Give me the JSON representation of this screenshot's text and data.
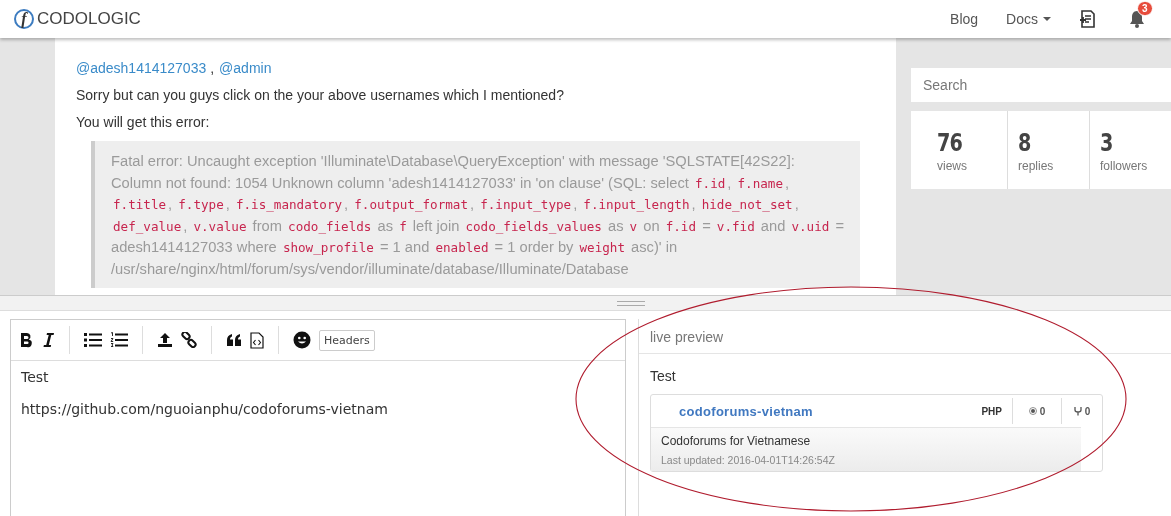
{
  "header": {
    "logo_letter": "f",
    "brand": "CODOLOGIC",
    "nav": [
      {
        "label": "Blog",
        "dropdown": false
      },
      {
        "label": "Docs",
        "dropdown": true
      }
    ],
    "notifications": "3"
  },
  "post": {
    "mentions": [
      "@adesh1414127033",
      "@admin"
    ],
    "mention_separator": ",",
    "paragraphs": [
      "Sorry but can you guys click on the your above usernames which I mentioned?",
      "You will get this error:"
    ],
    "quote": [
      {
        "kind": "text",
        "text": "Fatal error: Uncaught exception 'Illuminate\\Database\\QueryException' with message 'SQLSTATE[42S22]: Column not found: 1054 Unknown column 'adesh1414127033' in 'on clause' (SQL: select "
      },
      {
        "kind": "code",
        "text": "f.id"
      },
      {
        "kind": "text",
        "text": ", "
      },
      {
        "kind": "code",
        "text": "f.name"
      },
      {
        "kind": "text",
        "text": ", "
      },
      {
        "kind": "code",
        "text": "f.title"
      },
      {
        "kind": "text",
        "text": ", "
      },
      {
        "kind": "code",
        "text": "f.type"
      },
      {
        "kind": "text",
        "text": ", "
      },
      {
        "kind": "code",
        "text": "f.is_mandatory"
      },
      {
        "kind": "text",
        "text": ", "
      },
      {
        "kind": "code",
        "text": "f.output_format"
      },
      {
        "kind": "text",
        "text": ", "
      },
      {
        "kind": "code",
        "text": "f.input_type"
      },
      {
        "kind": "text",
        "text": ", "
      },
      {
        "kind": "code",
        "text": "f.input_length"
      },
      {
        "kind": "text",
        "text": ", "
      },
      {
        "kind": "code",
        "text": "hide_not_set"
      },
      {
        "kind": "text",
        "text": ", "
      },
      {
        "kind": "code",
        "text": "def_value"
      },
      {
        "kind": "text",
        "text": ", "
      },
      {
        "kind": "code",
        "text": "v.value"
      },
      {
        "kind": "text",
        "text": " from "
      },
      {
        "kind": "code",
        "text": "codo_fields"
      },
      {
        "kind": "text",
        "text": " as "
      },
      {
        "kind": "code",
        "text": "f"
      },
      {
        "kind": "text",
        "text": " left join "
      },
      {
        "kind": "code",
        "text": "codo_fields_values"
      },
      {
        "kind": "text",
        "text": " as "
      },
      {
        "kind": "code",
        "text": "v"
      },
      {
        "kind": "text",
        "text": " on "
      },
      {
        "kind": "code",
        "text": "f.id"
      },
      {
        "kind": "text",
        "text": " = "
      },
      {
        "kind": "code",
        "text": "v.fid"
      },
      {
        "kind": "text",
        "text": " and "
      },
      {
        "kind": "code",
        "text": "v.uid"
      },
      {
        "kind": "text",
        "text": " = adesh1414127033 where "
      },
      {
        "kind": "code",
        "text": "show_profile"
      },
      {
        "kind": "text",
        "text": " = 1 and "
      },
      {
        "kind": "code",
        "text": "enabled"
      },
      {
        "kind": "text",
        "text": " = 1 order by "
      },
      {
        "kind": "code",
        "text": "weight"
      },
      {
        "kind": "text",
        "text": " asc)' in /usr/share/nginx/html/forum/sys/vendor/illuminate/database/Illuminate/Database"
      }
    ]
  },
  "sidebar": {
    "search": {
      "placeholder": "Search"
    },
    "stats": [
      {
        "value": "76",
        "label": "views"
      },
      {
        "value": "8",
        "label": "replies"
      },
      {
        "value": "3",
        "label": "followers"
      }
    ]
  },
  "editor": {
    "toolbar": [
      {
        "kind": "bold"
      },
      {
        "kind": "italic"
      },
      {
        "kind": "sep"
      },
      {
        "kind": "ul"
      },
      {
        "kind": "ol"
      },
      {
        "kind": "sep"
      },
      {
        "kind": "upload"
      },
      {
        "kind": "link"
      },
      {
        "kind": "sep"
      },
      {
        "kind": "quote"
      },
      {
        "kind": "code"
      },
      {
        "kind": "sep"
      },
      {
        "kind": "emoji"
      },
      {
        "kind": "text",
        "label": "Headers"
      }
    ],
    "lines": [
      "Test",
      "https://github.com/nguoianphu/codoforums-vietnam"
    ]
  },
  "preview": {
    "label": "live preview",
    "text": "Test",
    "repo": {
      "name": "codoforums-vietnam",
      "language": "PHP",
      "stars": "0",
      "forks": "0",
      "description": "Codoforums for Vietnamese",
      "updated": "Last updated: 2016-04-01T14:26:54Z"
    }
  }
}
